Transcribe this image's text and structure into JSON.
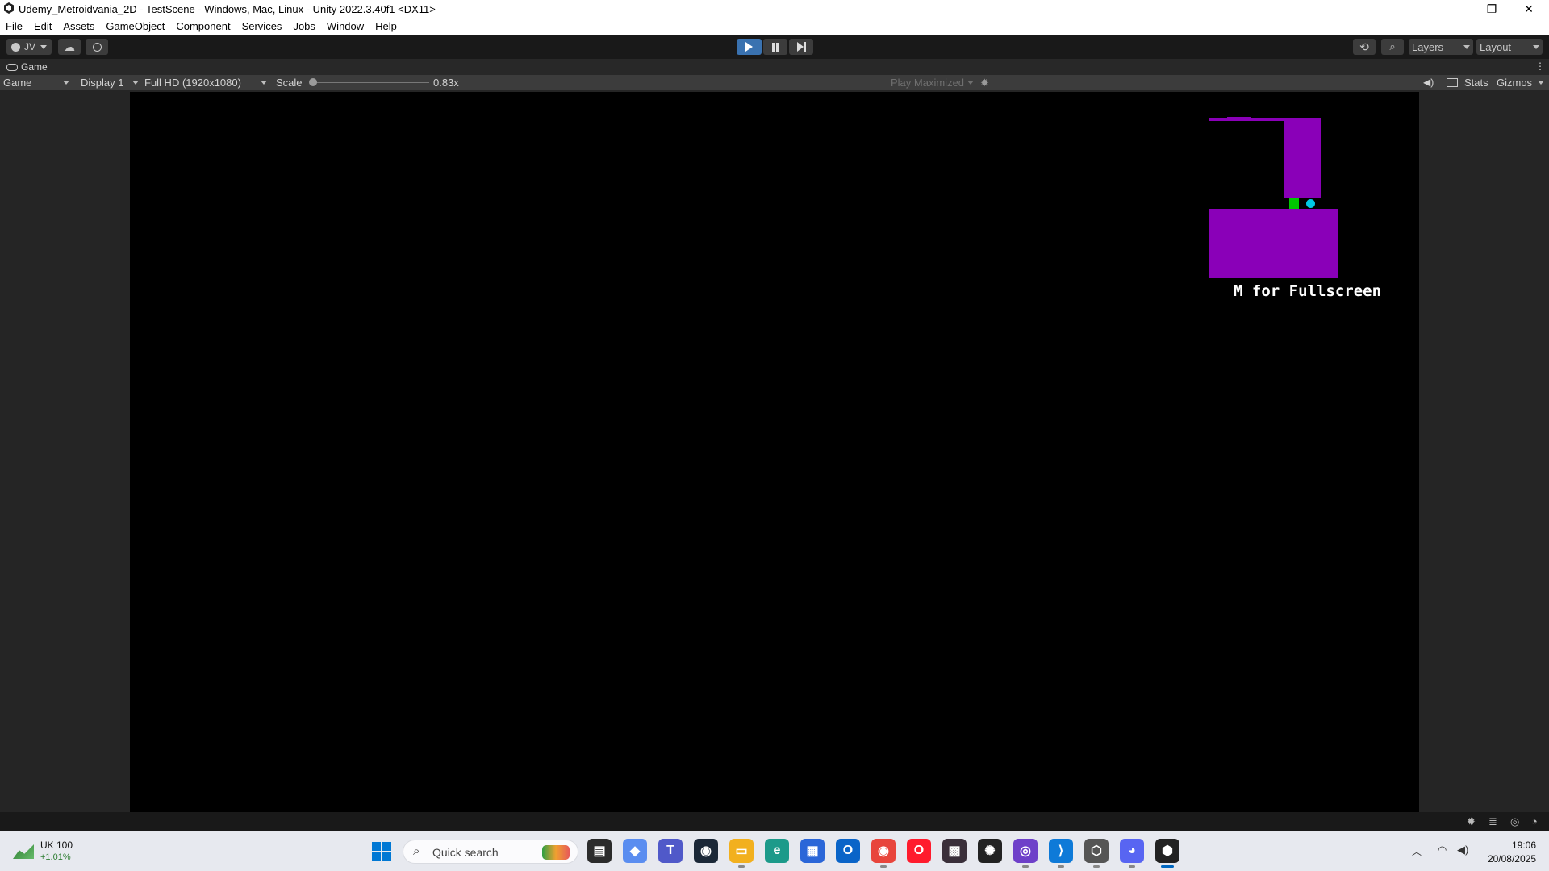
{
  "window": {
    "title": "Udemy_Metroidvania_2D - TestScene - Windows, Mac, Linux - Unity 2022.3.40f1 <DX11>",
    "minimize": "—",
    "maximize": "❐",
    "close": "✕"
  },
  "menu": [
    "File",
    "Edit",
    "Assets",
    "GameObject",
    "Component",
    "Services",
    "Jobs",
    "Window",
    "Help"
  ],
  "toolbar": {
    "account": "JV",
    "layers": "Layers",
    "layout": "Layout"
  },
  "game_tab": {
    "label": "Game",
    "view_mode": "Game",
    "display": "Display 1",
    "resolution": "Full HD (1920x1080)",
    "scale_label": "Scale",
    "scale_value": "0.83x",
    "scale_fraction": 0.0,
    "play_mode": "Play Maximized",
    "stats": "Stats",
    "gizmos": "Gizmos"
  },
  "game_view": {
    "hint_text": "M for Fullscreen",
    "colors": {
      "wall": "#8a00b8",
      "player": "#00c800",
      "orb": "#00c8e6"
    }
  },
  "taskbar": {
    "widget_name": "UK 100",
    "widget_change": "+1.01%",
    "search_placeholder": "Quick search",
    "time": "19:06",
    "date": "20/08/2025",
    "apps": [
      "file-explorer-black-icon",
      "copilot-icon",
      "teams-icon",
      "steam-icon",
      "folder-icon",
      "edge-icon",
      "store-icon",
      "outlook-icon",
      "chrome-icon",
      "opera-icon",
      "game-app-icon",
      "chatgpt-icon",
      "github-desktop-icon",
      "vscode-icon",
      "unity-hub-icon",
      "discord-icon",
      "unity-icon"
    ]
  }
}
